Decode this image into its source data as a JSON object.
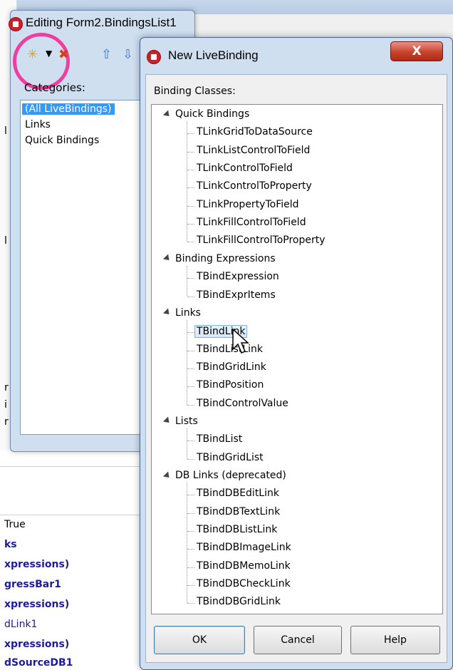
{
  "edit_window": {
    "title": "Editing Form2.BindingsList1",
    "categories_label": "Categories:",
    "categories": [
      "(All LiveBindings)",
      "Links",
      "Quick Bindings"
    ],
    "selected_category": "(All LiveBindings)"
  },
  "background_props": {
    "rows": [
      "True",
      "ks",
      "xpressions)",
      "gressBar1",
      "xpressions)",
      "dLink1",
      "xpressions)",
      "dSourceDB1"
    ]
  },
  "dialog": {
    "title": "New LiveBinding",
    "close_label": "X",
    "binding_classes_label": "Binding Classes:",
    "groups": [
      {
        "name": "Quick Bindings",
        "items": [
          "TLinkGridToDataSource",
          "TLinkListControlToField",
          "TLinkControlToField",
          "TLinkControlToProperty",
          "TLinkPropertyToField",
          "TLinkFillControlToField",
          "TLinkFillControlToProperty"
        ]
      },
      {
        "name": "Binding Expressions",
        "items": [
          "TBindExpression",
          "TBindExprItems"
        ]
      },
      {
        "name": "Links",
        "items": [
          "TBindLink",
          "TBindListLink",
          "TBindGridLink",
          "TBindPosition",
          "TBindControlValue"
        ]
      },
      {
        "name": "Lists",
        "items": [
          "TBindList",
          "TBindGridList"
        ]
      },
      {
        "name": "DB Links (deprecated)",
        "items": [
          "TBindDBEditLink",
          "TBindDBTextLink",
          "TBindDBListLink",
          "TBindDBImageLink",
          "TBindDBMemoLink",
          "TBindDBCheckLink",
          "TBindDBGridLink"
        ]
      }
    ],
    "selected_item": "TBindLink",
    "buttons": {
      "ok": "OK",
      "cancel": "Cancel",
      "help": "Help"
    }
  },
  "icons": [
    "app-icon",
    "new-binding-icon",
    "dropdown-arrow-icon",
    "delete-binding-icon",
    "move-up-icon",
    "move-down-icon",
    "mouse-cursor-icon"
  ]
}
